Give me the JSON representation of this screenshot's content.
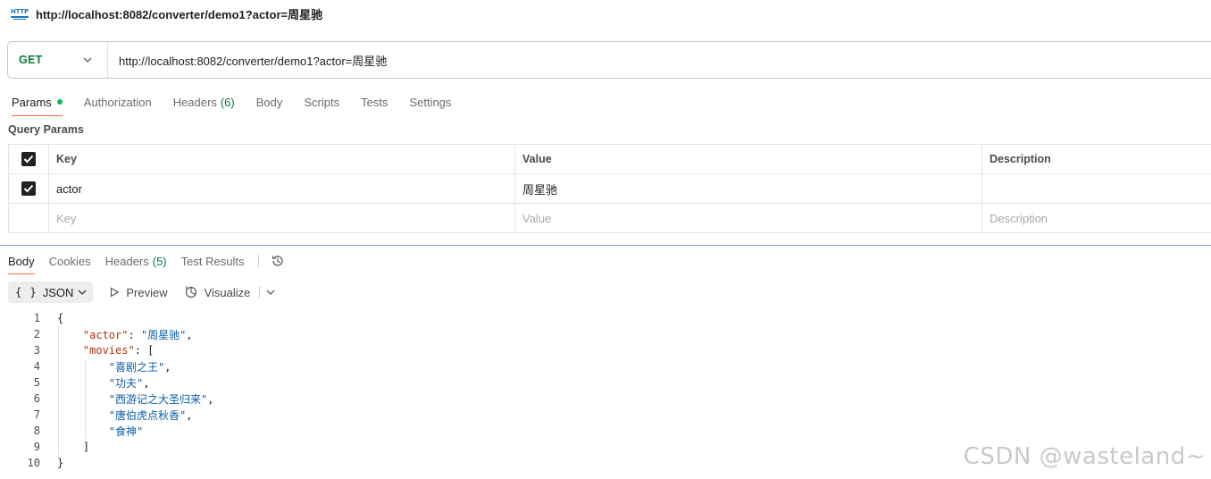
{
  "tab": {
    "title": "http://localhost:8082/converter/demo1?actor=周星驰",
    "icon": "http-request-icon",
    "icon_text": "HTTP"
  },
  "request": {
    "method": "GET",
    "url": "http://localhost:8082/converter/demo1?actor=周星驰"
  },
  "request_tabs": [
    {
      "label": "Params"
    },
    {
      "label": "Authorization"
    },
    {
      "label": "Headers",
      "count": "(6)"
    },
    {
      "label": "Body"
    },
    {
      "label": "Scripts"
    },
    {
      "label": "Tests"
    },
    {
      "label": "Settings"
    }
  ],
  "query_params": {
    "title": "Query Params",
    "headers": {
      "key": "Key",
      "value": "Value",
      "description": "Description"
    },
    "rows": [
      {
        "key": "actor",
        "value": "周星驰",
        "description": ""
      }
    ],
    "placeholder": {
      "key": "Key",
      "value": "Value",
      "description": "Description"
    }
  },
  "response_tabs": [
    {
      "label": "Body"
    },
    {
      "label": "Cookies"
    },
    {
      "label": "Headers",
      "count": "(5)"
    },
    {
      "label": "Test Results"
    }
  ],
  "toolbar": {
    "format": "JSON",
    "braces": "{ }",
    "preview": "Preview",
    "visualize": "Visualize"
  },
  "code_lines": [
    {
      "n": "1",
      "t": "{"
    },
    {
      "n": "2",
      "k": "\"actor\"",
      "p": ": ",
      "s": "\"周星驰\"",
      "e": ","
    },
    {
      "n": "3",
      "k": "\"movies\"",
      "p": ": ",
      "t": "["
    },
    {
      "n": "4",
      "s": "\"喜剧之王\"",
      "e": ","
    },
    {
      "n": "5",
      "s": "\"功夫\"",
      "e": ","
    },
    {
      "n": "6",
      "s": "\"西游记之大圣归来\"",
      "e": ","
    },
    {
      "n": "7",
      "s": "\"唐伯虎点秋香\"",
      "e": ","
    },
    {
      "n": "8",
      "s": "\"食神\""
    },
    {
      "n": "9",
      "t": "]"
    },
    {
      "n": "10",
      "t": "}"
    }
  ],
  "watermark": "CSDN @wasteland~",
  "colors": {
    "accent": "#ff6c37",
    "method_green": "#0b7a3e",
    "json_key": "#b0330c",
    "json_string": "#0b5fa6"
  }
}
